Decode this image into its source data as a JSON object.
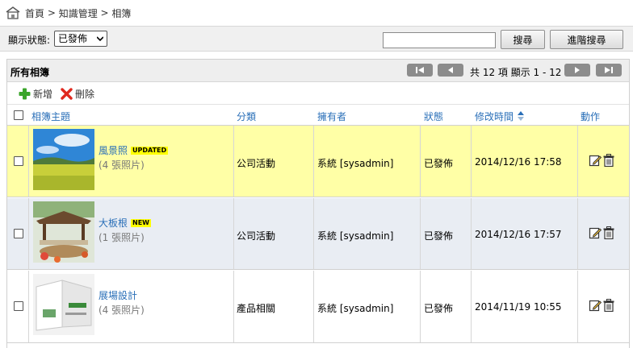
{
  "breadcrumb": {
    "home": "首頁",
    "sep1": " > ",
    "section": "知識管理",
    "sep2": " > ",
    "current": "相簿"
  },
  "filter": {
    "label": "顯示狀態:",
    "selected": "已發佈"
  },
  "search": {
    "value": "",
    "search_label": "搜尋",
    "advanced_label": "進階搜尋"
  },
  "panel": {
    "title": "所有相簿",
    "pager_info": "共 12 項 顯示 1 - 12"
  },
  "toolbar": {
    "add_label": "新增",
    "delete_label": "刪除"
  },
  "table": {
    "headers": {
      "subject": "相簿主題",
      "category": "分類",
      "owner": "擁有者",
      "status": "狀態",
      "modified": "修改時間",
      "actions": "動作"
    },
    "rows": [
      {
        "title": "風景照",
        "badge": "UPDATED",
        "count": "(4 張照片)",
        "category": "公司活動",
        "owner": "系統 [sysadmin]",
        "status": "已發佈",
        "modified": "2014/12/16 17:58"
      },
      {
        "title": "大板根",
        "badge": "NEW",
        "count": "(1 張照片)",
        "category": "公司活動",
        "owner": "系統 [sysadmin]",
        "status": "已發佈",
        "modified": "2014/12/16 17:57"
      },
      {
        "title": "展場設計",
        "badge": "",
        "count": "(4 張照片)",
        "category": "產品相關",
        "owner": "系統 [sysadmin]",
        "status": "已發佈",
        "modified": "2014/11/19 10:55"
      }
    ]
  },
  "colors": {
    "link": "#2a6fb8",
    "highlight_row": "#ffffa6",
    "alt_row": "#e9edf3",
    "badge_bg": "#ffff00"
  }
}
